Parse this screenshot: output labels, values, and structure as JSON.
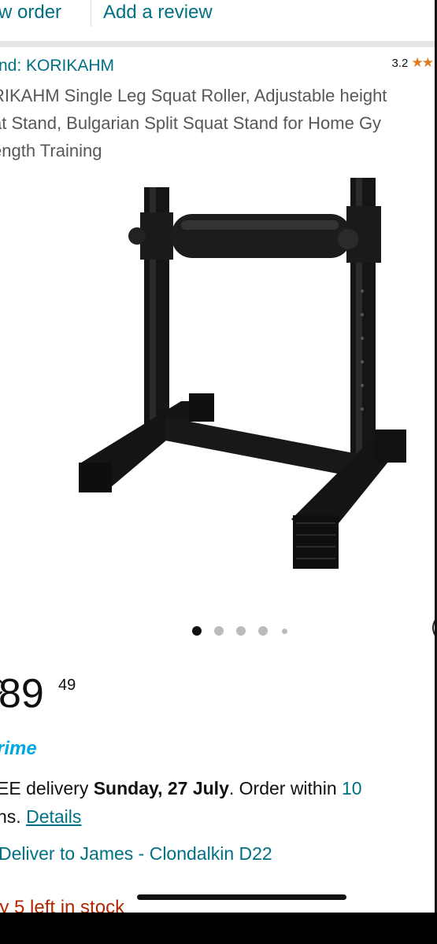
{
  "top_links": {
    "view_order": "w order",
    "add_review": "Add a review"
  },
  "brand": "nd: KORIKAHM",
  "rating": {
    "value": "3.2",
    "stars": "★★"
  },
  "title_lines": [
    "RIKAHM Single Leg Squat Roller, Adjustable height",
    "at Stand, Bulgarian Split Squat Stand for Home Gy",
    "ength Training"
  ],
  "carousel": {
    "active_index": 0,
    "count": 5
  },
  "price": {
    "currency": "€",
    "whole": "89",
    "fraction": "49"
  },
  "prime": "rime",
  "delivery": {
    "prefix": "EE delivery ",
    "date": "Sunday, 27 July",
    "order_within": ". Order within ",
    "countdown": "10",
    "line2_prefix": "ns. ",
    "details_link": "Details"
  },
  "deliver_to": "Deliver to James - Clondalkin D22",
  "stock": "ly 5 left in stock",
  "colors": {
    "link": "#007185",
    "star": "#de7921",
    "prime": "#00a8e1",
    "stock": "#b12704"
  }
}
